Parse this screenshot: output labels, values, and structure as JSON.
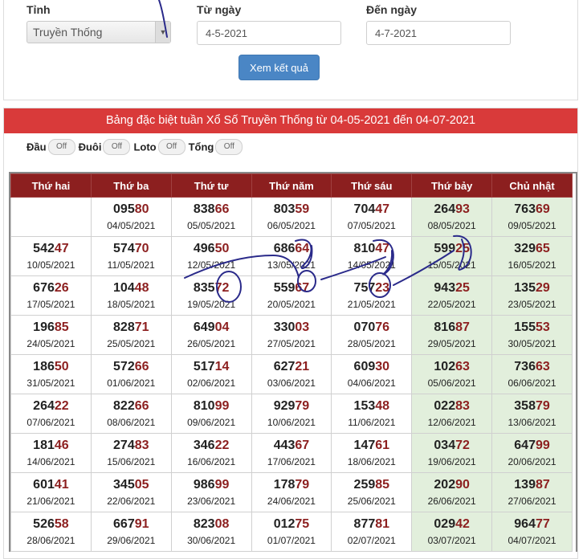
{
  "filter": {
    "province_label": "Tỉnh",
    "province_value": "Truyền Thống",
    "from_label": "Từ ngày",
    "from_value": "4-5-2021",
    "to_label": "Đến ngày",
    "to_value": "4-7-2021",
    "submit_label": "Xem kết quả"
  },
  "results": {
    "title": "Bảng đặc biệt tuần Xổ Số Truyền Thống từ 04-05-2021 đến 04-07-2021",
    "options": [
      {
        "label": "Đầu",
        "state": "Off"
      },
      {
        "label": "Đuôi",
        "state": "Off"
      },
      {
        "label": "Loto",
        "state": "Off"
      },
      {
        "label": "Tổng",
        "state": "Off"
      }
    ],
    "days": [
      "Thứ hai",
      "Thứ ba",
      "Thứ tư",
      "Thứ năm",
      "Thứ sáu",
      "Thứ bảy",
      "Chủ nhật"
    ],
    "weeks": [
      [
        null,
        {
          "head": "095",
          "tail": "80",
          "date": "04/05/2021"
        },
        {
          "head": "838",
          "tail": "66",
          "date": "05/05/2021"
        },
        {
          "head": "803",
          "tail": "59",
          "date": "06/05/2021"
        },
        {
          "head": "704",
          "tail": "47",
          "date": "07/05/2021"
        },
        {
          "head": "264",
          "tail": "93",
          "date": "08/05/2021"
        },
        {
          "head": "763",
          "tail": "69",
          "date": "09/05/2021"
        }
      ],
      [
        {
          "head": "542",
          "tail": "47",
          "date": "10/05/2021"
        },
        {
          "head": "574",
          "tail": "70",
          "date": "11/05/2021"
        },
        {
          "head": "496",
          "tail": "50",
          "date": "12/05/2021"
        },
        {
          "head": "686",
          "tail": "64",
          "date": "13/05/2021"
        },
        {
          "head": "810",
          "tail": "47",
          "date": "14/05/2021"
        },
        {
          "head": "599",
          "tail": "25",
          "date": "15/05/2021"
        },
        {
          "head": "329",
          "tail": "65",
          "date": "16/05/2021"
        }
      ],
      [
        {
          "head": "676",
          "tail": "26",
          "date": "17/05/2021"
        },
        {
          "head": "104",
          "tail": "48",
          "date": "18/05/2021"
        },
        {
          "head": "835",
          "tail": "72",
          "date": "19/05/2021"
        },
        {
          "head": "559",
          "tail": "67",
          "date": "20/05/2021"
        },
        {
          "head": "757",
          "tail": "23",
          "date": "21/05/2021"
        },
        {
          "head": "943",
          "tail": "25",
          "date": "22/05/2021"
        },
        {
          "head": "135",
          "tail": "29",
          "date": "23/05/2021"
        }
      ],
      [
        {
          "head": "196",
          "tail": "85",
          "date": "24/05/2021"
        },
        {
          "head": "828",
          "tail": "71",
          "date": "25/05/2021"
        },
        {
          "head": "649",
          "tail": "04",
          "date": "26/05/2021"
        },
        {
          "head": "330",
          "tail": "03",
          "date": "27/05/2021"
        },
        {
          "head": "070",
          "tail": "76",
          "date": "28/05/2021"
        },
        {
          "head": "816",
          "tail": "87",
          "date": "29/05/2021"
        },
        {
          "head": "155",
          "tail": "53",
          "date": "30/05/2021"
        }
      ],
      [
        {
          "head": "186",
          "tail": "50",
          "date": "31/05/2021"
        },
        {
          "head": "572",
          "tail": "66",
          "date": "01/06/2021"
        },
        {
          "head": "517",
          "tail": "14",
          "date": "02/06/2021"
        },
        {
          "head": "627",
          "tail": "21",
          "date": "03/06/2021"
        },
        {
          "head": "609",
          "tail": "30",
          "date": "04/06/2021"
        },
        {
          "head": "102",
          "tail": "63",
          "date": "05/06/2021"
        },
        {
          "head": "736",
          "tail": "63",
          "date": "06/06/2021"
        }
      ],
      [
        {
          "head": "264",
          "tail": "22",
          "date": "07/06/2021"
        },
        {
          "head": "822",
          "tail": "66",
          "date": "08/06/2021"
        },
        {
          "head": "810",
          "tail": "99",
          "date": "09/06/2021"
        },
        {
          "head": "929",
          "tail": "79",
          "date": "10/06/2021"
        },
        {
          "head": "153",
          "tail": "48",
          "date": "11/06/2021"
        },
        {
          "head": "022",
          "tail": "83",
          "date": "12/06/2021"
        },
        {
          "head": "358",
          "tail": "79",
          "date": "13/06/2021"
        }
      ],
      [
        {
          "head": "181",
          "tail": "46",
          "date": "14/06/2021"
        },
        {
          "head": "274",
          "tail": "83",
          "date": "15/06/2021"
        },
        {
          "head": "346",
          "tail": "22",
          "date": "16/06/2021"
        },
        {
          "head": "443",
          "tail": "67",
          "date": "17/06/2021"
        },
        {
          "head": "147",
          "tail": "61",
          "date": "18/06/2021"
        },
        {
          "head": "034",
          "tail": "72",
          "date": "19/06/2021"
        },
        {
          "head": "647",
          "tail": "99",
          "date": "20/06/2021"
        }
      ],
      [
        {
          "head": "601",
          "tail": "41",
          "date": "21/06/2021"
        },
        {
          "head": "345",
          "tail": "05",
          "date": "22/06/2021"
        },
        {
          "head": "986",
          "tail": "99",
          "date": "23/06/2021"
        },
        {
          "head": "178",
          "tail": "79",
          "date": "24/06/2021"
        },
        {
          "head": "259",
          "tail": "85",
          "date": "25/06/2021"
        },
        {
          "head": "202",
          "tail": "90",
          "date": "26/06/2021"
        },
        {
          "head": "139",
          "tail": "87",
          "date": "27/06/2021"
        }
      ],
      [
        {
          "head": "526",
          "tail": "58",
          "date": "28/06/2021"
        },
        {
          "head": "667",
          "tail": "91",
          "date": "29/06/2021"
        },
        {
          "head": "823",
          "tail": "08",
          "date": "30/06/2021"
        },
        {
          "head": "012",
          "tail": "75",
          "date": "01/07/2021"
        },
        {
          "head": "877",
          "tail": "81",
          "date": "02/07/2021"
        },
        {
          "head": "029",
          "tail": "42",
          "date": "03/07/2021"
        },
        {
          "head": "964",
          "tail": "77",
          "date": "04/07/2021"
        }
      ]
    ]
  },
  "colors": {
    "header_red": "#d93a3a",
    "table_header": "#8c1f1f",
    "weekend_bg": "#e2efdc",
    "button_blue": "#4a86c5",
    "scribble_ink": "#2a2a8a"
  }
}
